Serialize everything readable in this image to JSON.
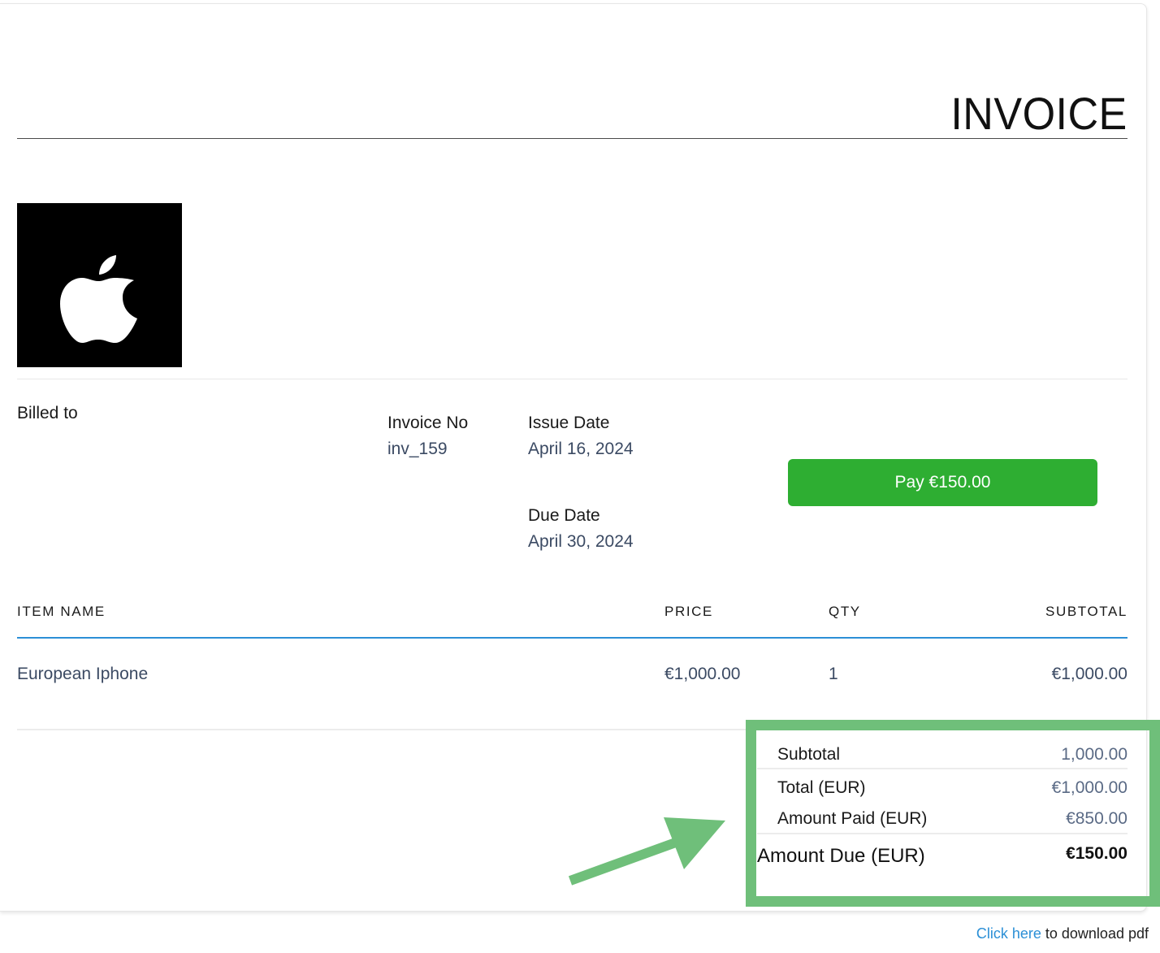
{
  "invoice": {
    "title": "INVOICE",
    "logo_icon": "apple-logo",
    "billed_to_label": "Billed to",
    "invoice_no_label": "Invoice No",
    "invoice_no_value": "inv_159",
    "issue_date_label": "Issue Date",
    "issue_date_value": "April 16, 2024",
    "due_date_label": "Due Date",
    "due_date_value": "April 30, 2024",
    "pay_button_label": "Pay €150.00",
    "pay_button_color": "#2eae32"
  },
  "table": {
    "headers": [
      "ITEM NAME",
      "PRICE",
      "QTY",
      "SUBTOTAL"
    ],
    "rows": [
      {
        "item_name": "European Iphone",
        "price": "€1,000.00",
        "qty": "1",
        "subtotal": "€1,000.00"
      }
    ],
    "header_rule_color": "#2b8fd6"
  },
  "summary": {
    "subtotal_label": "Subtotal",
    "subtotal_value": "1,000.00",
    "total_label": "Total (EUR)",
    "total_value": "€1,000.00",
    "amount_paid_label": "Amount Paid (EUR)",
    "amount_paid_value": "€850.00",
    "amount_due_label": "Amount Due (EUR)",
    "amount_due_value": "€150.00",
    "highlight_color": "#6fbf7a",
    "arrow_icon": "arrow-icon"
  },
  "footer": {
    "link_text": "Click here",
    "trailing_text": " to download pdf",
    "link_color": "#2b8fd6"
  }
}
